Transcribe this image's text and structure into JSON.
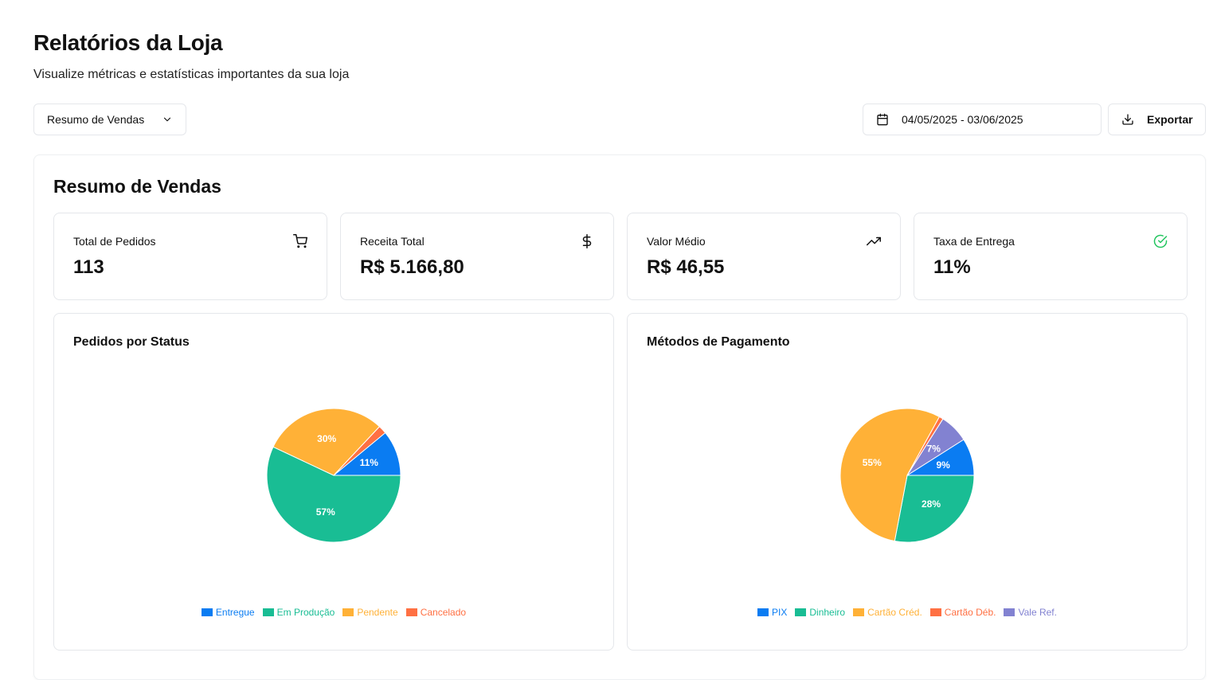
{
  "header": {
    "title": "Relatórios da Loja",
    "subtitle": "Visualize métricas e estatísticas importantes da sua loja"
  },
  "toolbar": {
    "report_type": "Resumo de Vendas",
    "date_range": "04/05/2025 - 03/06/2025",
    "export_label": "Exportar"
  },
  "panel": {
    "title": "Resumo de Vendas",
    "stats": [
      {
        "label": "Total de Pedidos",
        "value": "113",
        "icon": "cart-icon"
      },
      {
        "label": "Receita Total",
        "value": "R$ 5.166,80",
        "icon": "dollar-icon"
      },
      {
        "label": "Valor Médio",
        "value": "R$ 46,55",
        "icon": "trending-up-icon"
      },
      {
        "label": "Taxa de Entrega",
        "value": "11%",
        "icon": "check-circle-icon"
      }
    ]
  },
  "colors": {
    "blue": "#0a7cf2",
    "green": "#19bd94",
    "orange": "#ffb137",
    "red": "#ff7043",
    "purple": "#8282d1",
    "check_green": "#22c55e"
  },
  "chart_data": [
    {
      "type": "pie",
      "title": "Pedidos por Status",
      "categories": [
        "Entregue",
        "Em Produção",
        "Pendente",
        "Cancelado"
      ],
      "values": [
        11,
        57,
        30,
        2
      ],
      "data_labels": [
        "11%",
        "57%",
        "30%",
        ""
      ],
      "colors": [
        "#0a7cf2",
        "#19bd94",
        "#ffb137",
        "#ff7043"
      ],
      "legend": "bottom"
    },
    {
      "type": "pie",
      "title": "Métodos de Pagamento",
      "categories": [
        "PIX",
        "Dinheiro",
        "Cartão Créd.",
        "Cartão Déb.",
        "Vale Ref."
      ],
      "values": [
        9,
        28,
        55,
        1,
        7
      ],
      "data_labels": [
        "9%",
        "28%",
        "55%",
        "",
        "7%"
      ],
      "colors": [
        "#0a7cf2",
        "#19bd94",
        "#ffb137",
        "#ff7043",
        "#8282d1"
      ],
      "legend": "bottom"
    }
  ]
}
